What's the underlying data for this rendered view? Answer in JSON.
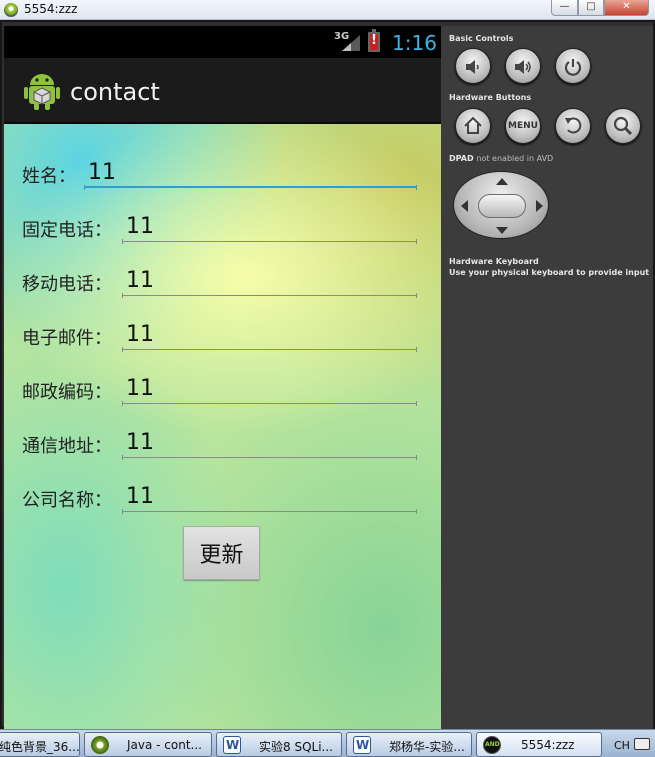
{
  "window": {
    "title": "5554:zzz",
    "minimize_glyph": "—",
    "maximize_glyph": "□",
    "close_glyph": "✕"
  },
  "statusbar": {
    "network": "3G",
    "clock": "1:16",
    "clock_color": "#3bb5e6"
  },
  "app": {
    "title": "contact",
    "icon": "android-logo-icon"
  },
  "form": {
    "fields": [
      {
        "label": "姓名：",
        "value": "11"
      },
      {
        "label": "固定电话：",
        "value": "11"
      },
      {
        "label": "移动电话：",
        "value": "11"
      },
      {
        "label": "电子邮件：",
        "value": "11"
      },
      {
        "label": "邮政编码：",
        "value": "11"
      },
      {
        "label": "通信地址：",
        "value": "11"
      },
      {
        "label": "公司名称：",
        "value": "11"
      }
    ],
    "submit_label": "更新",
    "focus_color": "#2f9fd0"
  },
  "controls": {
    "basic_title": "Basic Controls",
    "hardware_title": "Hardware Buttons",
    "menu_label": "MENU",
    "dpad_title": "DPAD",
    "dpad_note": "not enabled in AVD",
    "keyboard_title": "Hardware Keyboard",
    "keyboard_note": "Use your physical keyboard to provide input"
  },
  "taskbar": {
    "items": [
      {
        "label": "纯色背景_36...",
        "icon": "image-icon"
      },
      {
        "label": "Java - cont...",
        "icon": "java-icon"
      },
      {
        "label": "实验8  SQLi...",
        "icon": "word-icon"
      },
      {
        "label": "郑杨华-实验...",
        "icon": "word-icon"
      },
      {
        "label": "5554:zzz",
        "icon": "android-emulator-icon"
      }
    ],
    "language": "CH"
  }
}
